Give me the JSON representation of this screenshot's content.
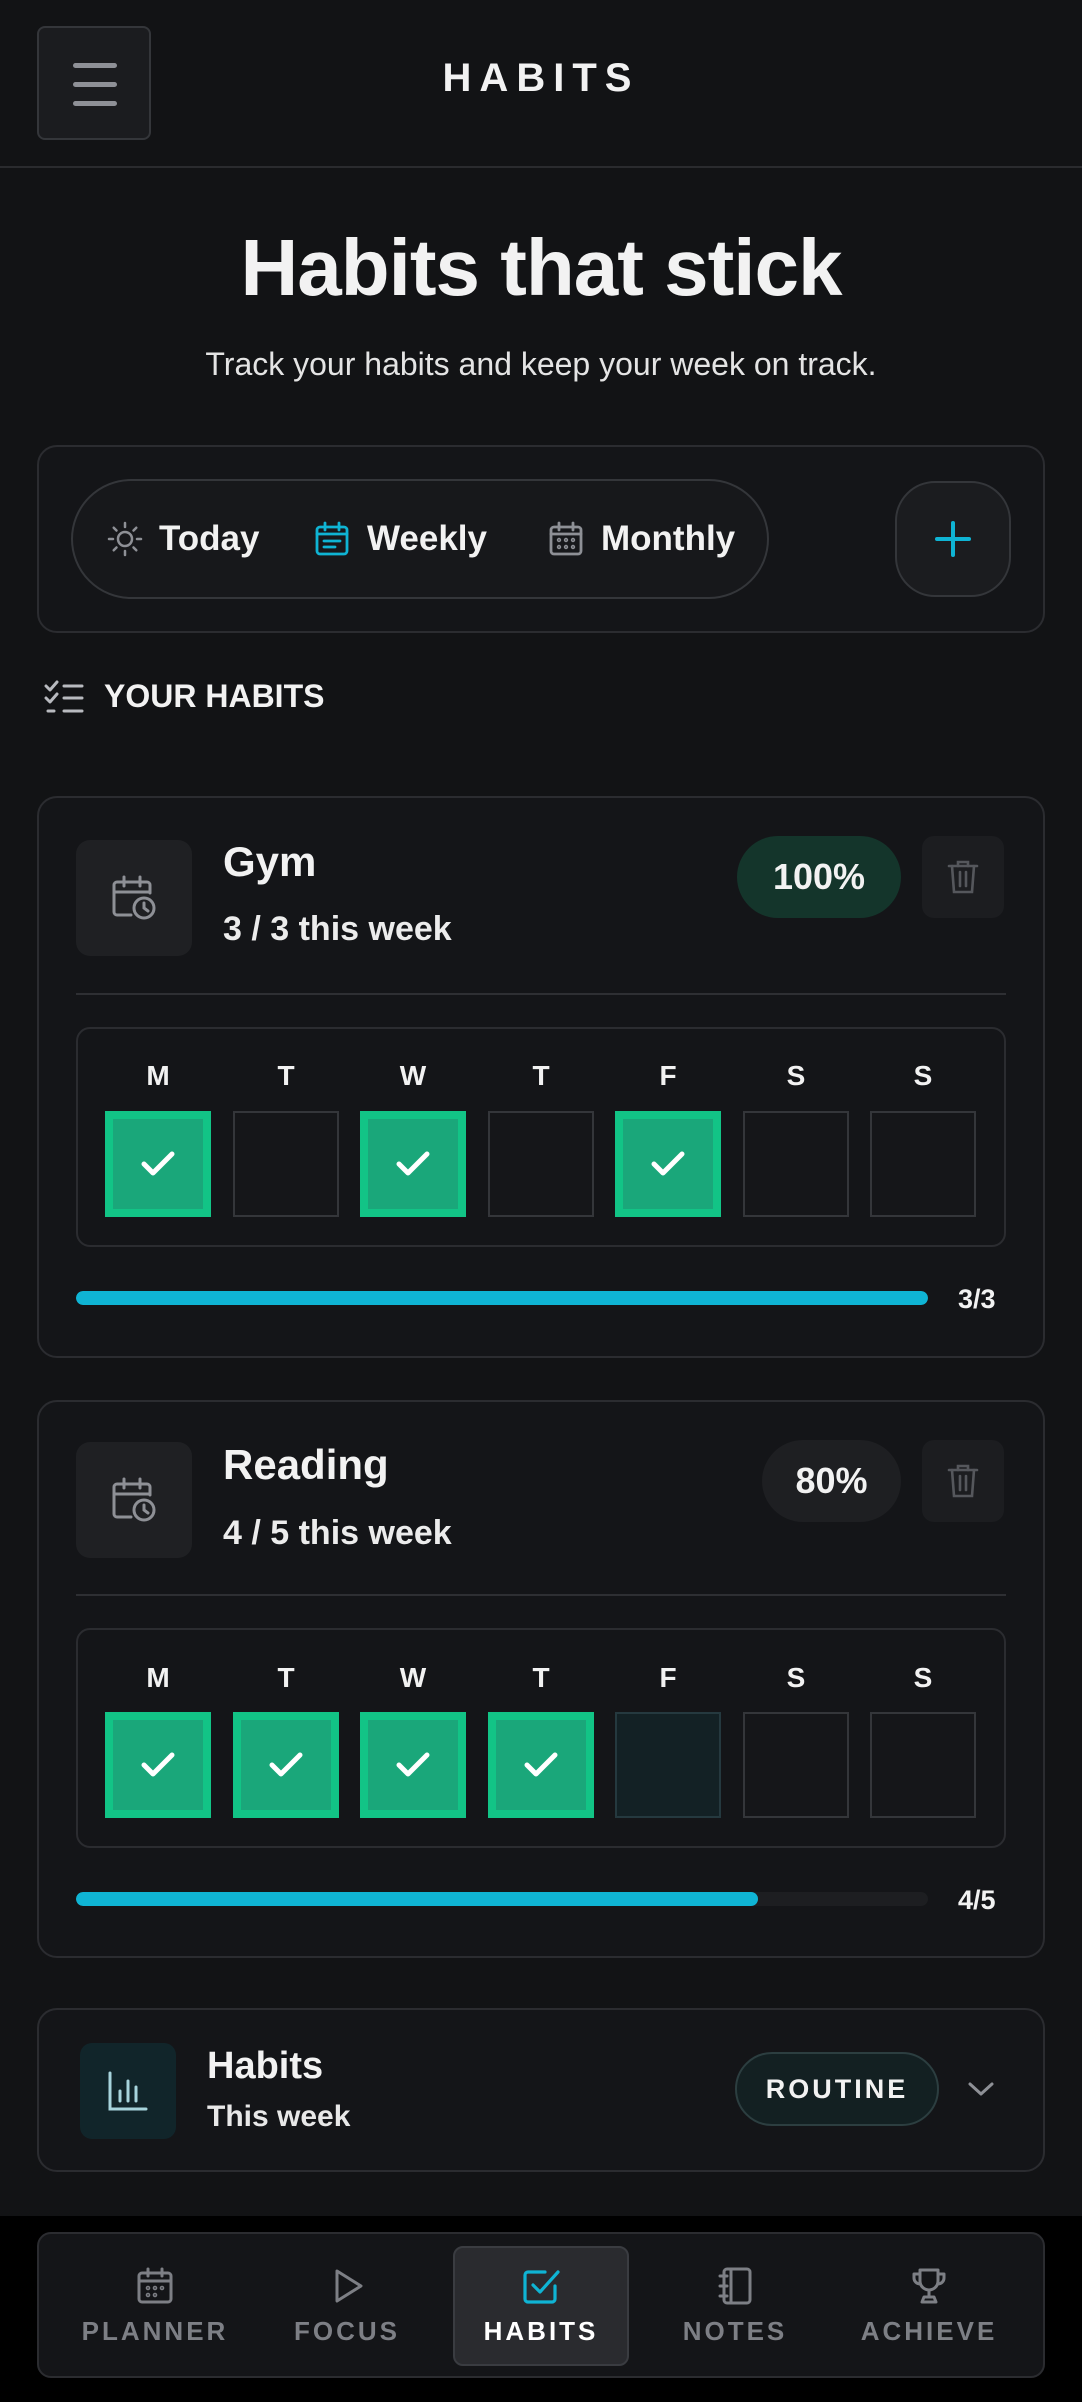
{
  "header": {
    "title": "HABITS",
    "menu_icon": "hamburger-menu-icon"
  },
  "hero": {
    "title": "Habits that stick",
    "subtitle": "Track your habits and keep your week on track."
  },
  "view_switcher": {
    "options": [
      {
        "label": "Today",
        "icon": "sun-icon",
        "active": false
      },
      {
        "label": "Weekly",
        "icon": "calendar-list-icon",
        "active": true
      },
      {
        "label": "Monthly",
        "icon": "calendar-grid-icon",
        "active": false
      }
    ],
    "add_icon": "plus-icon"
  },
  "section": {
    "label": "YOUR HABITS",
    "icon": "checklist-icon"
  },
  "habits": [
    {
      "name": "Gym",
      "count_text": "3 / 3 this week",
      "percent": "100%",
      "progress": 1.0,
      "progress_label": "3/3",
      "day_labels": [
        "M",
        "T",
        "W",
        "T",
        "F",
        "S",
        "S"
      ],
      "days": [
        "done",
        "empty",
        "done",
        "empty",
        "done",
        "empty",
        "empty"
      ]
    },
    {
      "name": "Reading",
      "count_text": "4 / 5 this week",
      "percent": "80%",
      "progress": 0.8,
      "progress_label": "4/5",
      "day_labels": [
        "M",
        "T",
        "W",
        "T",
        "F",
        "S",
        "S"
      ],
      "days": [
        "done",
        "done",
        "done",
        "done",
        "today",
        "empty",
        "empty"
      ]
    }
  ],
  "summary": {
    "title": "Habits",
    "subtitle": "This week",
    "badge": "ROUTINE",
    "icon": "bar-chart-icon"
  },
  "bottom_nav": [
    {
      "label": "PLANNER",
      "icon": "calendar-icon",
      "active": false
    },
    {
      "label": "FOCUS",
      "icon": "play-icon",
      "active": false
    },
    {
      "label": "HABITS",
      "icon": "checkbox-icon",
      "active": true
    },
    {
      "label": "NOTES",
      "icon": "notebook-icon",
      "active": false
    },
    {
      "label": "ACHIEVE",
      "icon": "trophy-icon",
      "active": false
    }
  ],
  "colors": {
    "background": "#121315",
    "accent": "#0fb4d4",
    "done_green": "#1aa77a",
    "percent_badge_full": "#14352b"
  }
}
